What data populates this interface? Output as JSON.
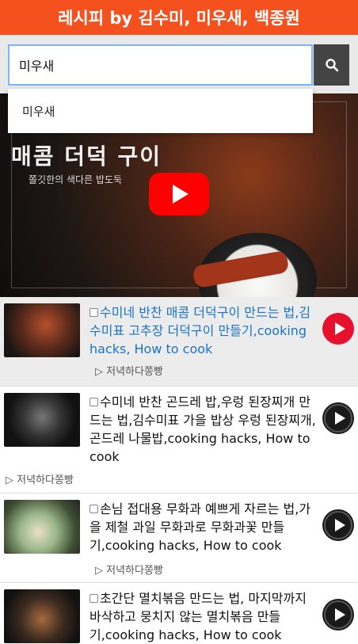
{
  "header": {
    "title": "레시피 by 김수미, 미우새, 백종원"
  },
  "search": {
    "value": "미우새",
    "suggestion": "미우새"
  },
  "video": {
    "art_title": "매콤 더덕 구이",
    "art_sub": "쫄깃한의 색다른 밥도둑"
  },
  "results": [
    {
      "title": "수미네 반찬 매콤 더덕구이 만드는 법,김수미표 고추장 더덕구이 만들기,cooking hacks, How to cook",
      "channel": "▷ 저녁하다쫑빵"
    },
    {
      "title": "수미네 반찬 곤드레 밥,우렁 된장찌개 만드는 법,김수미표 가을 밥상 우렁 된장찌개,곤드레 나물밥,cooking hacks, How to cook",
      "channel": "▷ 저녁하다쫑빵"
    },
    {
      "title": "손님 접대용 무화과 예쁘게 자르는 법,가을 제철 과일 무화과로 무화과꽃 만들기,cooking hacks, How to cook",
      "channel": "▷ 저녁하다쫑빵"
    },
    {
      "title": "초간단 멸치볶음 만드는 법, 마지막까지 바삭하고 뭉치지 않는 멸치볶음 만들기,cooking hacks, How to cook",
      "channel": ""
    }
  ],
  "colors": {
    "header_bg": "#f4511e",
    "active_title": "#1a73c8",
    "play_red": "#ff0000"
  },
  "icons": {
    "search": "search-icon",
    "play": "play-icon"
  }
}
